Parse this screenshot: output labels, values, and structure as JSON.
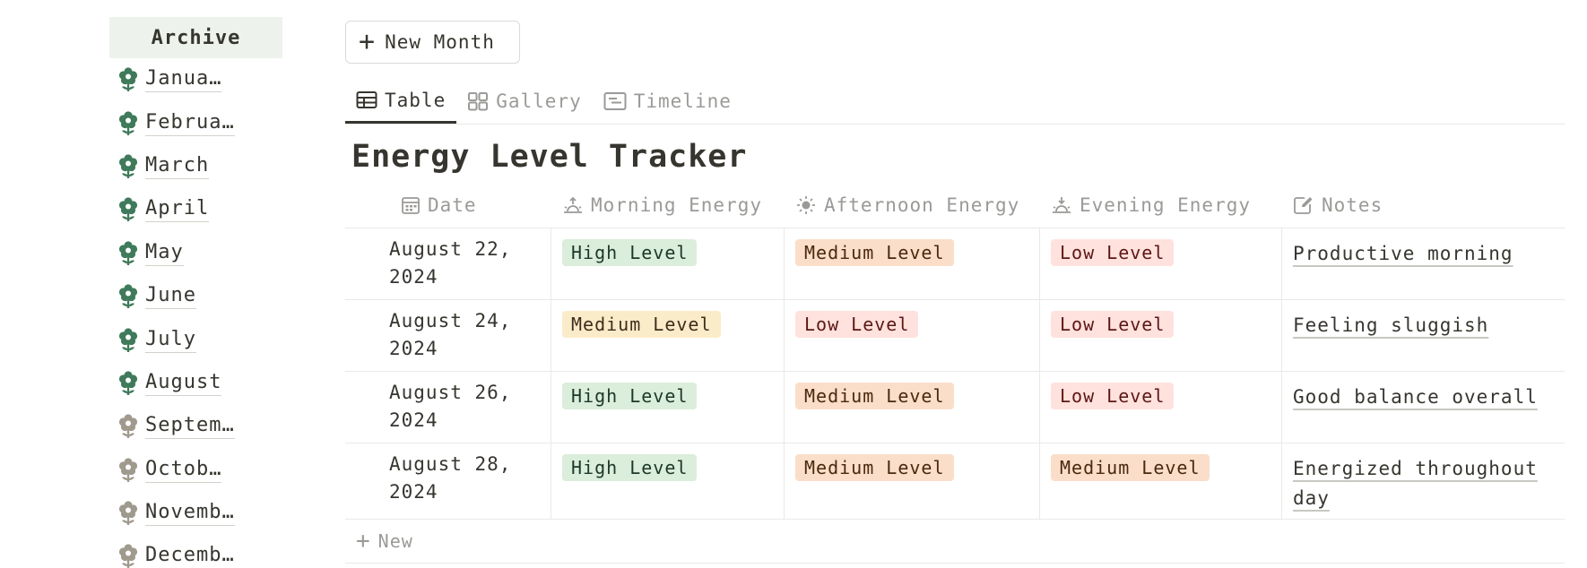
{
  "sidebar": {
    "header": "Archive",
    "months": [
      {
        "label": "Janua…",
        "active": true
      },
      {
        "label": "Februa…",
        "active": true
      },
      {
        "label": "March",
        "active": true
      },
      {
        "label": "April",
        "active": true
      },
      {
        "label": "May",
        "active": true
      },
      {
        "label": "June",
        "active": true
      },
      {
        "label": "July",
        "active": true
      },
      {
        "label": "August",
        "active": true
      },
      {
        "label": "Septem…",
        "active": false
      },
      {
        "label": "Octob…",
        "active": false
      },
      {
        "label": "Novemb…",
        "active": false
      },
      {
        "label": "Decemb…",
        "active": false
      }
    ],
    "icon_colors": {
      "active": "#3f7a5a",
      "inactive": "#a09a8e"
    }
  },
  "toolbar": {
    "new_month_label": "New Month"
  },
  "tabs": [
    {
      "label": "Table",
      "icon": "table-icon",
      "active": true
    },
    {
      "label": "Gallery",
      "icon": "gallery-icon",
      "active": false
    },
    {
      "label": "Timeline",
      "icon": "timeline-icon",
      "active": false
    }
  ],
  "title": "Energy Level Tracker",
  "table": {
    "columns": [
      {
        "label": "Date",
        "icon": "calendar-icon"
      },
      {
        "label": "Morning Energy",
        "icon": "sunrise-icon"
      },
      {
        "label": "Afternoon Energy",
        "icon": "sun-icon"
      },
      {
        "label": "Evening Energy",
        "icon": "sunset-icon"
      },
      {
        "label": "Notes",
        "icon": "edit-icon"
      }
    ],
    "rows": [
      {
        "date_line1": "August 22,",
        "date_line2": "2024",
        "morning": "High Level",
        "afternoon": "Medium Level",
        "evening": "Low Level",
        "notes": "Productive morning"
      },
      {
        "date_line1": "August 24,",
        "date_line2": "2024",
        "morning": "Medium Level",
        "afternoon": "Low Level",
        "evening": "Low Level",
        "notes": "Feeling sluggish"
      },
      {
        "date_line1": "August 26,",
        "date_line2": "2024",
        "morning": "High Level",
        "afternoon": "Medium Level",
        "evening": "Low Level",
        "notes": "Good balance overall"
      },
      {
        "date_line1": "August 28,",
        "date_line2": "2024",
        "morning": "High Level",
        "afternoon": "Medium Level",
        "evening": "Medium Level",
        "notes": "Energized throughout day"
      }
    ],
    "new_label": "New"
  },
  "colors": {
    "high_bg": "#dbeddb",
    "medium_bg": "#fadec9",
    "medium_yellow_bg": "#fbecc9",
    "low_bg": "#ffe2dd",
    "archive_bg": "#edf3ec"
  }
}
